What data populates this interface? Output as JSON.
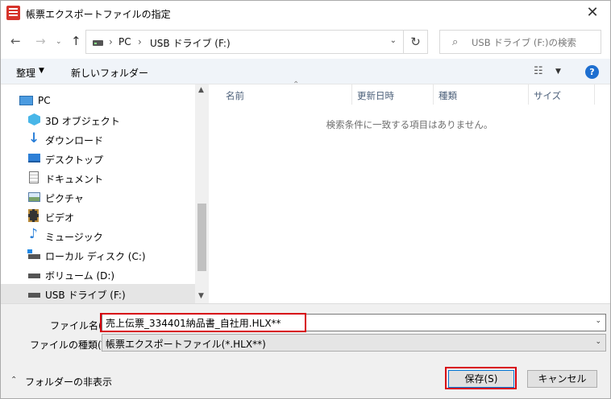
{
  "window": {
    "title": "帳票エクスポートファイルの指定",
    "close_label": "✕"
  },
  "address": {
    "crumbs": [
      "PC",
      "USB ドライブ (F:)"
    ],
    "separator": "›",
    "search_placeholder": "USB ドライブ (F:)の検索"
  },
  "toolbar": {
    "organize_label": "整理",
    "new_folder_label": "新しいフォルダー",
    "help_label": "?"
  },
  "nav": {
    "items": [
      {
        "label": "PC",
        "icon": "pc-icon"
      },
      {
        "label": "3D オブジェクト",
        "icon": "3d-objects-icon"
      },
      {
        "label": "ダウンロード",
        "icon": "download-icon"
      },
      {
        "label": "デスクトップ",
        "icon": "desktop-icon"
      },
      {
        "label": "ドキュメント",
        "icon": "document-icon"
      },
      {
        "label": "ピクチャ",
        "icon": "picture-icon"
      },
      {
        "label": "ビデオ",
        "icon": "video-icon"
      },
      {
        "label": "ミュージック",
        "icon": "music-icon"
      },
      {
        "label": "ローカル ディスク (C:)",
        "icon": "local-disk-icon"
      },
      {
        "label": "ボリューム (D:)",
        "icon": "drive-icon"
      },
      {
        "label": "USB ドライブ (F:)",
        "icon": "usb-drive-icon",
        "selected": true
      }
    ]
  },
  "file_list": {
    "columns": [
      "名前",
      "更新日時",
      "種類",
      "サイズ"
    ],
    "empty_message": "検索条件に一致する項目はありません。"
  },
  "form": {
    "filename_label": "ファイル名(N):",
    "filename_value": "売上伝票_334401納品書_自社用.HLX**",
    "filetype_label": "ファイルの種類(T):",
    "filetype_value": "帳票エクスポートファイル(*.HLX**)",
    "hide_folders_label": "フォルダーの非表示",
    "save_label": "保存(S)",
    "cancel_label": "キャンセル"
  },
  "colors": {
    "highlight": "#d7000f",
    "help": "#1e6fd0",
    "selected_row": "#e5e5e5"
  }
}
